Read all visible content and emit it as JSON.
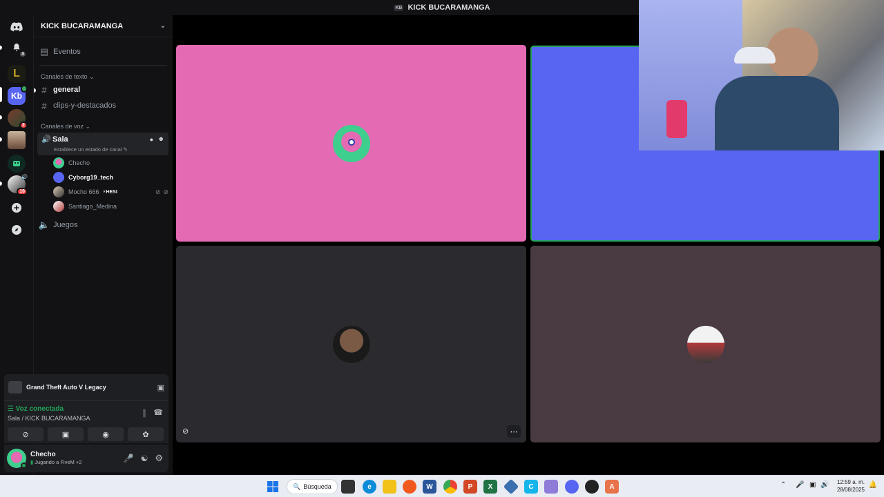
{
  "window": {
    "title": "KICK BUCARAMANGA",
    "tag": "KB"
  },
  "rail": {
    "notification_count": "3",
    "kb_server_label": "Kb",
    "kb_badge": "",
    "server2_badge": "2",
    "server5_badge": "16"
  },
  "guild": {
    "name": "KICK BUCARAMANGA"
  },
  "channels": {
    "events_label": "Eventos",
    "text_category": "Canales de texto",
    "text": [
      {
        "name": "general"
      },
      {
        "name": "clips-y-destacados"
      }
    ],
    "voice_category": "Canales de voz",
    "voice_active": {
      "name": "Sala",
      "status_hint": "Establece un estado de canal"
    },
    "voice_users": [
      {
        "name": "Checho"
      },
      {
        "name": "Cyborg19_tech"
      },
      {
        "name": "Mocho 666",
        "tag": "HESI"
      },
      {
        "name": "Santiago_Medina"
      }
    ],
    "voice_other": "Juegos"
  },
  "activity": {
    "game": "Grand Theft Auto V Legacy"
  },
  "voice_status": {
    "state": "Voz conectada",
    "location": "Sala / KICK BUCARAMANGA"
  },
  "user": {
    "name": "Checho",
    "activity": "Jugando a FiveM",
    "extra": "+2"
  },
  "taskbar": {
    "search_label": "Búsqueda",
    "time": "12:59 a. m.",
    "date": "28/08/2025"
  },
  "colors": {
    "tile1": "#e46ab3",
    "tile2": "#5865f2",
    "tile3": "#2b2a2f",
    "tile4": "#4a3a42",
    "discord_blurple": "#5865f2",
    "voice_green": "#23a55a"
  }
}
